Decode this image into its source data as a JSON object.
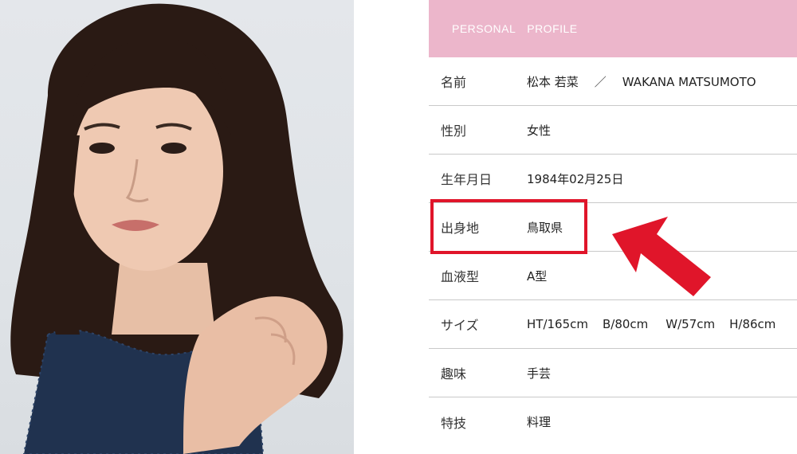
{
  "photo": {
    "subject": "portrait-photo"
  },
  "profile": {
    "header": "PERSONAL　PROFILE",
    "rows": [
      {
        "label": "名前",
        "value_jp": "松本 若菜",
        "separator": "／",
        "value_en": "WAKANA MATSUMOTO"
      },
      {
        "label": "性別",
        "value": "女性"
      },
      {
        "label": "生年月日",
        "value": "1984年02月25日"
      },
      {
        "label": "出身地",
        "value": "鳥取県"
      },
      {
        "label": "血液型",
        "value": "A型"
      },
      {
        "label": "サイズ",
        "size": {
          "ht": "HT/165cm",
          "b": "B/80cm",
          "w": "W/57cm",
          "h": "H/86cm"
        }
      },
      {
        "label": "趣味",
        "value": "手芸"
      },
      {
        "label": "特技",
        "value": "料理"
      }
    ]
  },
  "colors": {
    "header_bg": "#ecb6cb",
    "annotation": "#e0152a"
  }
}
